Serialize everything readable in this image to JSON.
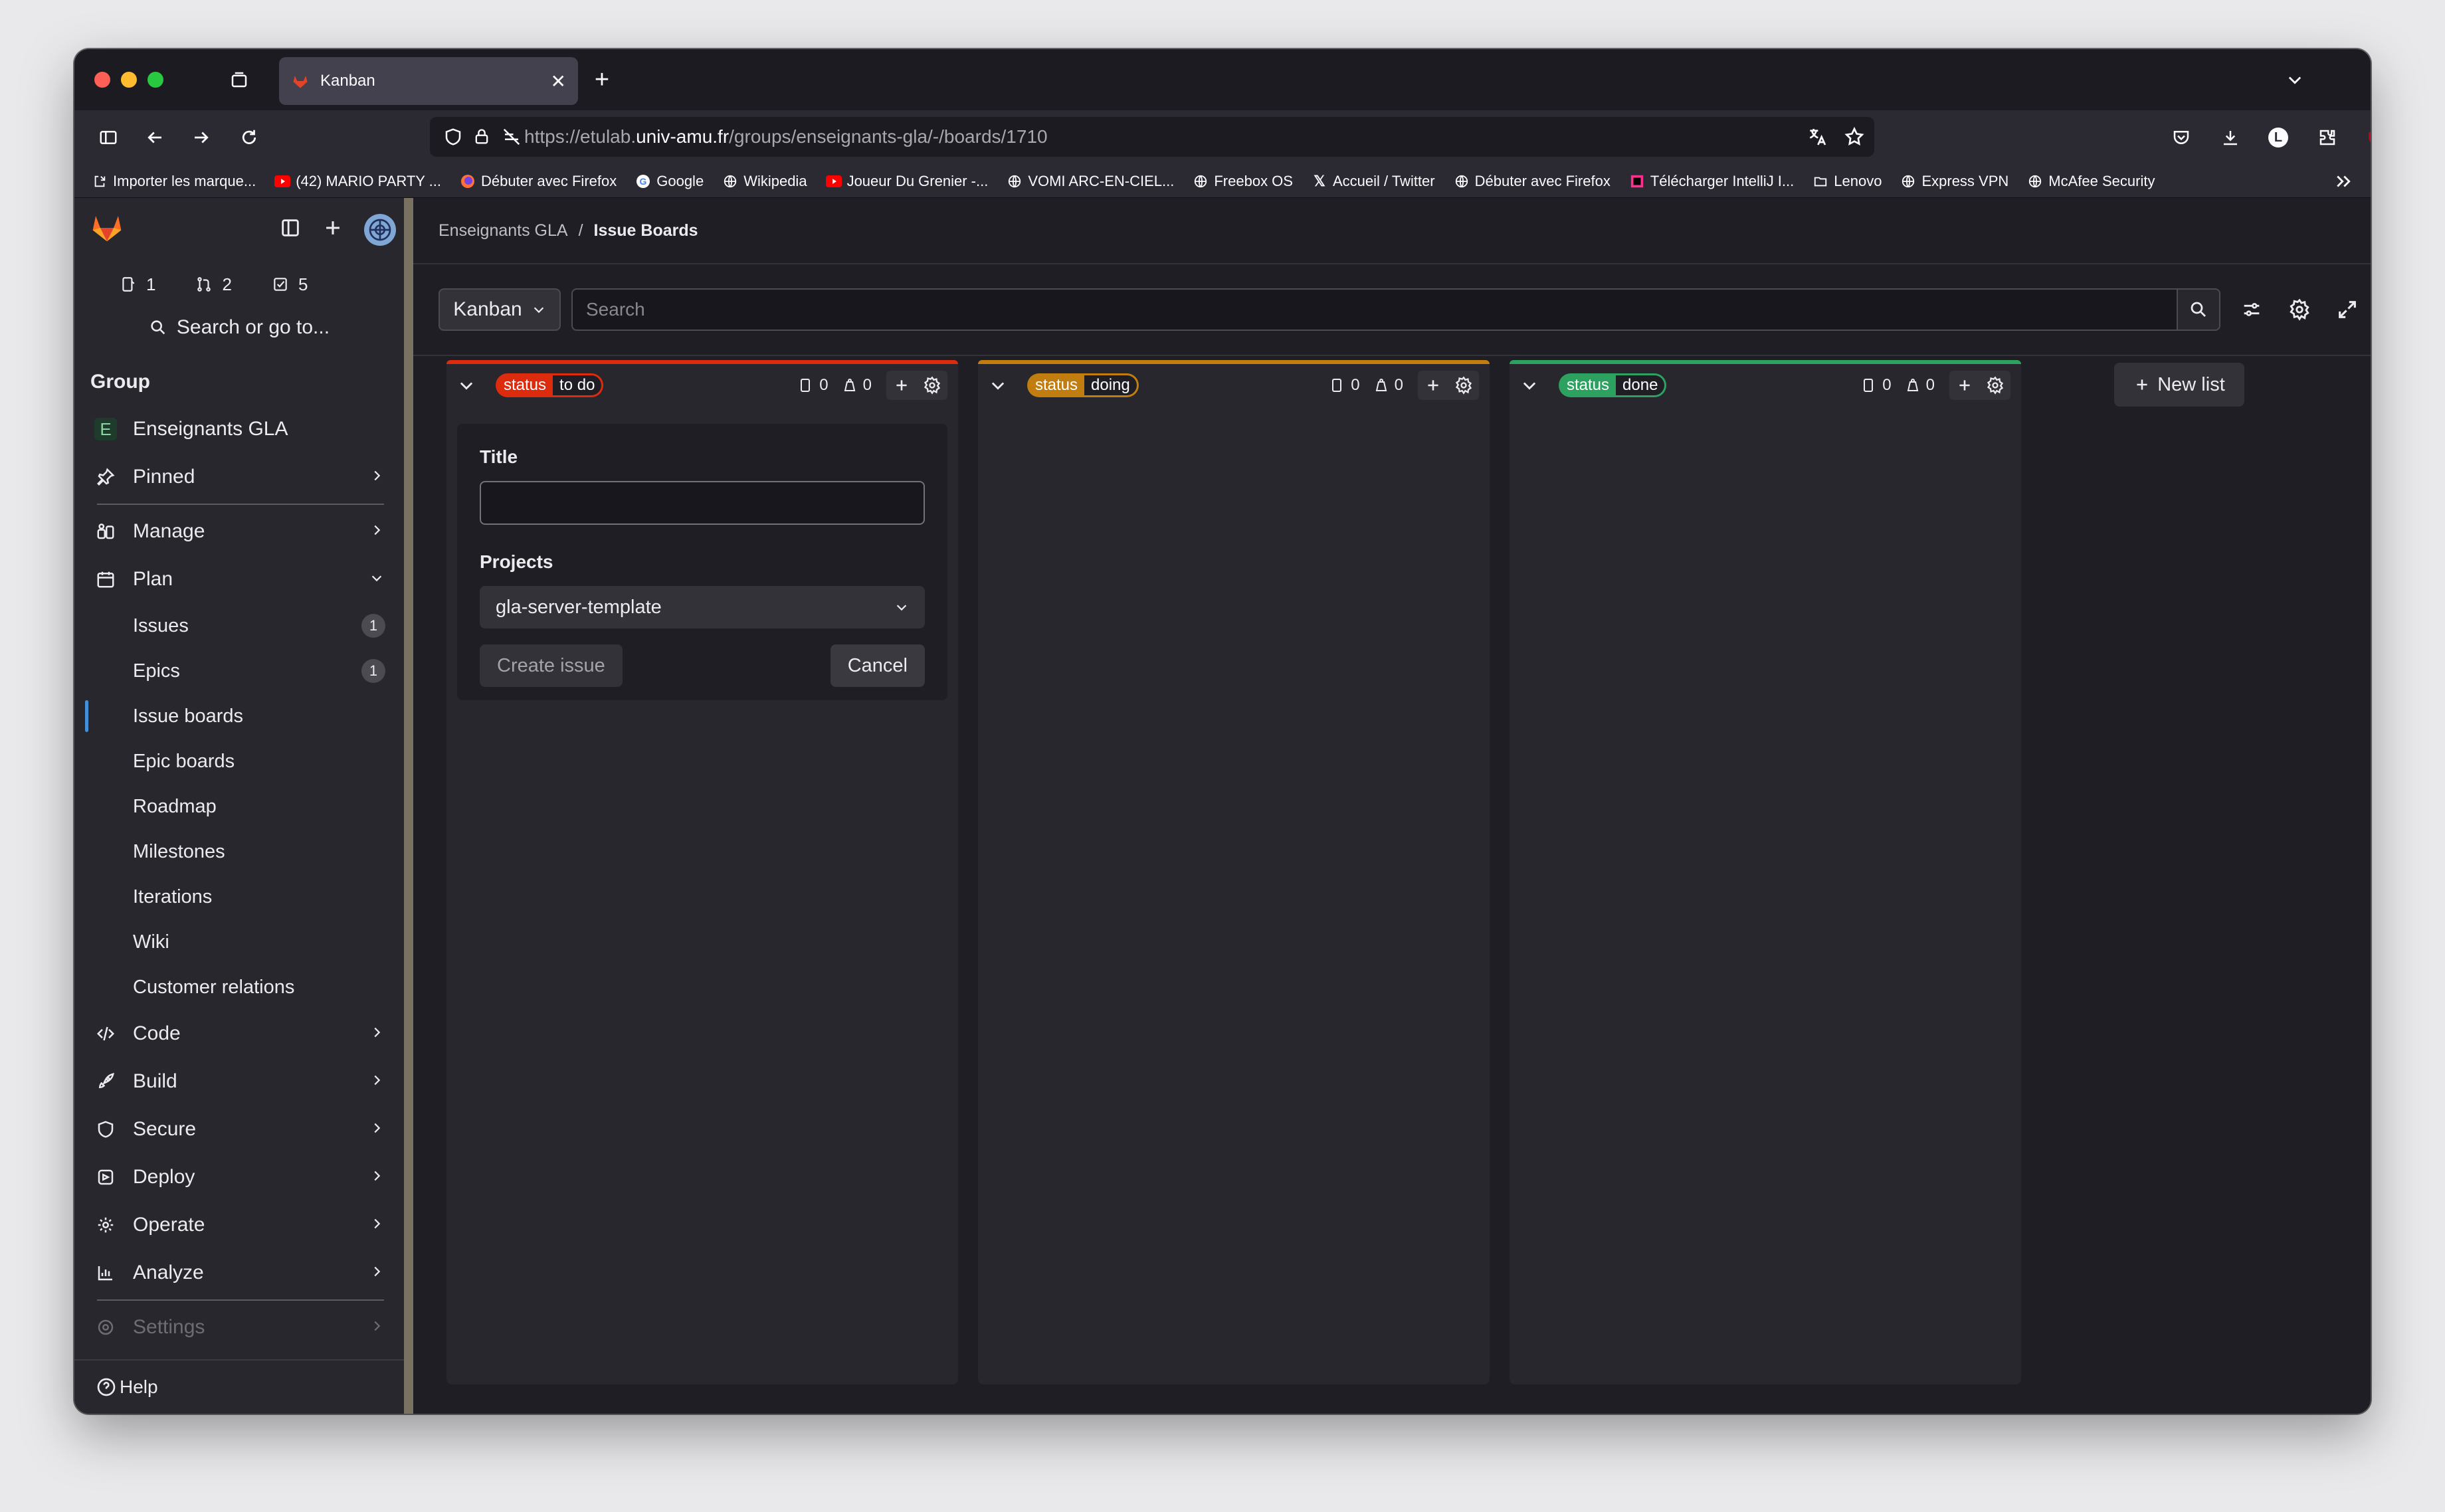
{
  "browser": {
    "tab_title": "Kanban",
    "url_prefix": "https://etulab.",
    "url_domain": "univ-amu.fr",
    "url_path": "/groups/enseignants-gla/-/boards/1710"
  },
  "bookmarks": [
    "Importer les marque...",
    "(42) MARIO PARTY ...",
    "Débuter avec Firefox",
    "Google",
    "Wikipedia",
    "Joueur Du Grenier -...",
    "VOMI ARC-EN-CIEL...",
    "Freebox OS",
    "Accueil / Twitter",
    "Débuter avec Firefox",
    "Télécharger IntelliJ I...",
    "Lenovo",
    "Express VPN",
    "McAfee Security"
  ],
  "sidebar": {
    "counts": {
      "issues": "1",
      "merge_requests": "2",
      "todos": "5"
    },
    "search_label": "Search or go to...",
    "group_heading": "Group",
    "group_avatar": "E",
    "group_name": "Enseignants GLA",
    "pinned": "Pinned",
    "manage": "Manage",
    "plan": "Plan",
    "plan_items": [
      {
        "label": "Issues",
        "badge": "1"
      },
      {
        "label": "Epics",
        "badge": "1"
      },
      {
        "label": "Issue boards"
      },
      {
        "label": "Epic boards"
      },
      {
        "label": "Roadmap"
      },
      {
        "label": "Milestones"
      },
      {
        "label": "Iterations"
      },
      {
        "label": "Wiki"
      },
      {
        "label": "Customer relations"
      }
    ],
    "sections": [
      "Code",
      "Build",
      "Secure",
      "Deploy",
      "Operate",
      "Analyze"
    ],
    "settings": "Settings",
    "help": "Help"
  },
  "breadcrumb": {
    "parent": "Enseignants GLA",
    "separator": "/",
    "current": "Issue Boards"
  },
  "filter": {
    "board_name": "Kanban",
    "search_placeholder": "Search"
  },
  "lists": [
    {
      "key": "status",
      "value": "to do",
      "color": "#dd2b0e",
      "issues": "0",
      "weight": "0"
    },
    {
      "key": "status",
      "value": "doing",
      "color": "#c17d10",
      "issues": "0",
      "weight": "0"
    },
    {
      "key": "status",
      "value": "done",
      "color": "#2da160",
      "issues": "0",
      "weight": "0"
    }
  ],
  "new_issue_form": {
    "title_label": "Title",
    "title_value": "",
    "projects_label": "Projects",
    "project_selected": "gla-server-template",
    "create_label": "Create issue",
    "cancel_label": "Cancel"
  },
  "new_list_label": "New list"
}
